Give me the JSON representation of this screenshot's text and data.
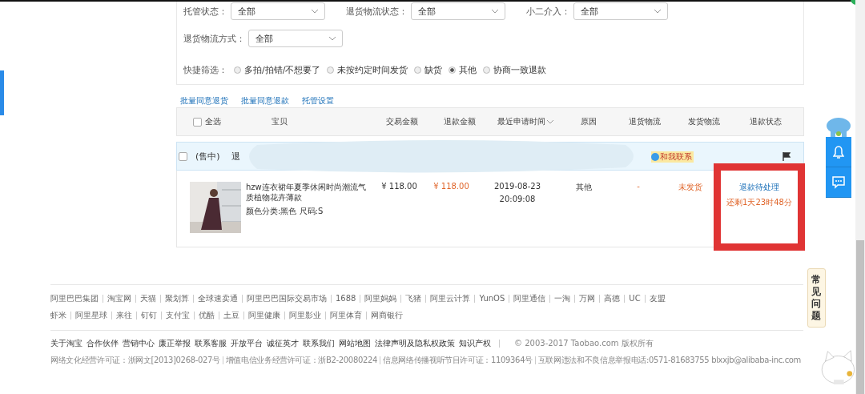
{
  "filters": [
    {
      "label": "托管状态：",
      "value": "全部"
    },
    {
      "label": "退货物流状态：",
      "value": "全部"
    },
    {
      "label": "小二介入：",
      "value": "全部"
    }
  ],
  "filter_row2": [
    {
      "label": "退货物流方式：",
      "value": "全部"
    }
  ],
  "quick_filter": {
    "label": "快捷筛选：",
    "options": [
      {
        "label": "多拍/拍错/不想要了",
        "selected": false
      },
      {
        "label": "未按约定时间发货",
        "selected": false
      },
      {
        "label": "缺货",
        "selected": false
      },
      {
        "label": "其他",
        "selected": true
      },
      {
        "label": "协商一致退款",
        "selected": false
      }
    ]
  },
  "batch_links": [
    "批量同意退货",
    "批量同意退款",
    "托管设置"
  ],
  "table": {
    "select_all": {
      "label": "全选",
      "checked": false
    },
    "columns": [
      "宝贝",
      "交易金额",
      "退款金额",
      "最近申请时间",
      "原因",
      "退货物流",
      "发货物流",
      "退款状态"
    ],
    "order": {
      "checked": false,
      "status": "(售中)",
      "text": "退",
      "contact": "和我联系"
    },
    "rows": [
      {
        "title": "hzw连衣裙年夏季休闲时尚潮流气质植物花卉薄款",
        "sku": "颜色分类:黑色  尺码:S",
        "trade_amount": "¥ 118.00",
        "refund_amount": "¥ 118.00",
        "date": "2019-08-23",
        "time": "20:09:08",
        "reason": "其他",
        "return_logistics": "-",
        "ship_logistics": "未发货",
        "refund_status": "退款待处理",
        "remaining": "还剩1天23时48分"
      }
    ]
  },
  "side_tab": "常见问题",
  "footer": {
    "links_row1": [
      "阿里巴巴集团",
      "淘宝网",
      "天猫",
      "聚划算",
      "全球速卖通",
      "阿里巴巴国际交易市场",
      "1688",
      "阿里妈妈",
      "飞猪",
      "阿里云计算",
      "YunOS",
      "阿里通信",
      "一淘",
      "万网",
      "高德",
      "UC",
      "友盟"
    ],
    "links_row2": [
      "虾米",
      "阿里星球",
      "来往",
      "钉钉",
      "支付宝",
      "优酷",
      "土豆",
      "阿里健康",
      "阿里影业",
      "阿里体育",
      "网商银行"
    ],
    "about_links": [
      "关于淘宝",
      "合作伙伴",
      "营销中心",
      "廉正举报",
      "联系客服",
      "开放平台",
      "诚征英才",
      "联系我们",
      "网站地图",
      "法律声明及隐私权政策",
      "知识产权"
    ],
    "copyright": "© 2003-2017 Taobao.com 版权所有",
    "licenses": [
      "网络文化经营许可证：浙网文[2013]0268-027号",
      "增值电信业务经营许可证：浙B2-20080224",
      "信息网络传播视听节目许可证：1109364号",
      "互联网违法和不良信息举报电话:0571-81683755 blxxjb@alibaba-inc.com"
    ]
  }
}
